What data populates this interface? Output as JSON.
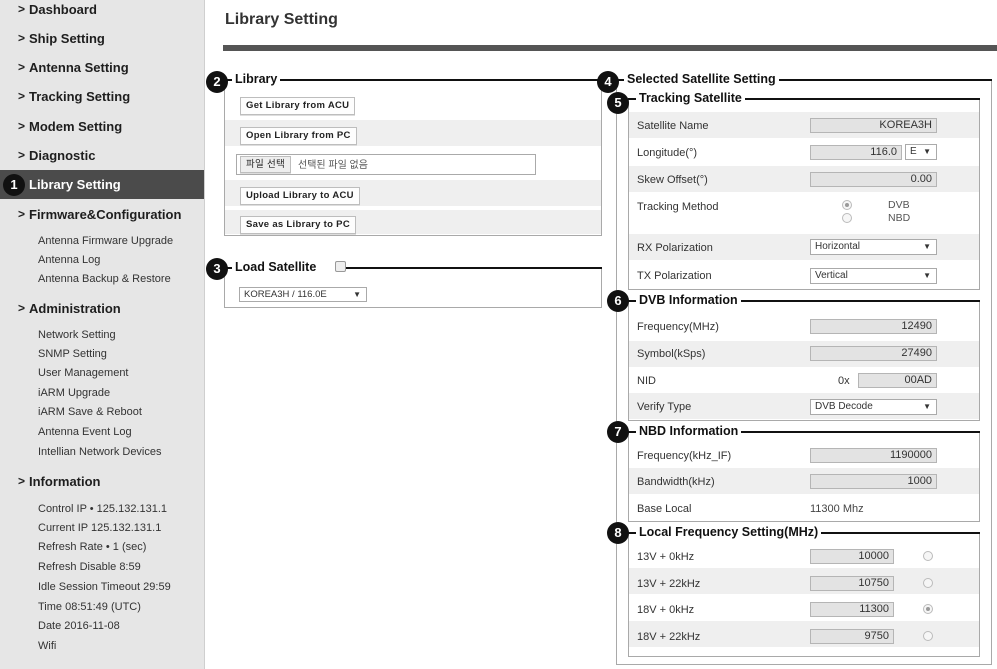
{
  "sidebar": {
    "nav": {
      "dashboard": "Dashboard",
      "ship": "Ship Setting",
      "antenna": "Antenna Setting",
      "tracking": "Tracking Setting",
      "modem": "Modem Setting",
      "diagnostic": "Diagnostic",
      "library": "Library Setting",
      "firmware": "Firmware&Configuration",
      "administration": "Administration",
      "information": "Information"
    },
    "firmware_sub": [
      "Antenna Firmware Upgrade",
      "Antenna Log",
      "Antenna Backup & Restore"
    ],
    "admin_sub": [
      "Network Setting",
      "SNMP Setting",
      "User Management",
      "iARM Upgrade",
      "iARM Save & Reboot",
      "Antenna Event Log",
      "Intellian Network Devices"
    ],
    "info": [
      "Control IP • 125.132.131.1",
      "Current IP  125.132.131.1",
      "Refresh Rate •    1 (sec)",
      "Refresh Disable  8:59",
      "Idle Session Timeout  29:59",
      "Time  08:51:49 (UTC)",
      "Date  2016-11-08",
      "Wifi"
    ]
  },
  "markers": [
    "1",
    "2",
    "3",
    "4",
    "5",
    "6",
    "7",
    "8"
  ],
  "page_title": "Library Setting",
  "library": {
    "legend": "Library",
    "btn_get": "Get Library from ACU",
    "btn_open": "Open Library from PC",
    "file_button": "파일 선택",
    "file_status": "선택된 파일 없음",
    "btn_upload": "Upload Library to ACU",
    "btn_save": "Save as Library to PC"
  },
  "load_satellite": {
    "legend": "Load Satellite",
    "select_value": "KOREA3H / 116.0E"
  },
  "selected": {
    "legend": "Selected Satellite Setting"
  },
  "tracking": {
    "legend": "Tracking Satellite",
    "sat_name_label": "Satellite Name",
    "sat_name": "KOREA3H",
    "longitude_label": "Longitude(°)",
    "longitude": "116.0",
    "longitude_dir": "E",
    "skew_label": "Skew Offset(°)",
    "skew": "0.00",
    "method_label": "Tracking Method",
    "method_dvb": "DVB",
    "method_nbd": "NBD",
    "method_selected": "DVB",
    "rx_label": "RX Polarization",
    "rx": "Horizontal",
    "tx_label": "TX Polarization",
    "tx": "Vertical"
  },
  "dvb": {
    "legend": "DVB Information",
    "freq_label": "Frequency(MHz)",
    "freq": "12490",
    "symbol_label": "Symbol(kSps)",
    "symbol": "27490",
    "nid_label": "NID",
    "nid_prefix": "0x",
    "nid": "00AD",
    "verify_label": "Verify Type",
    "verify": "DVB Decode"
  },
  "nbd": {
    "legend": "NBD Information",
    "freq_label": "Frequency(kHz_IF)",
    "freq": "1190000",
    "bw_label": "Bandwidth(kHz)",
    "bw": "1000",
    "base_label": "Base Local",
    "base": "11300 Mhz"
  },
  "local": {
    "legend": "Local Frequency Setting(MHz)",
    "rows": [
      {
        "label": "13V + 0kHz",
        "value": "10000",
        "selected": false
      },
      {
        "label": "13V + 22kHz",
        "value": "10750",
        "selected": false
      },
      {
        "label": "18V + 0kHz",
        "value": "11300",
        "selected": true
      },
      {
        "label": "18V + 22kHz",
        "value": "9750",
        "selected": false
      }
    ]
  }
}
